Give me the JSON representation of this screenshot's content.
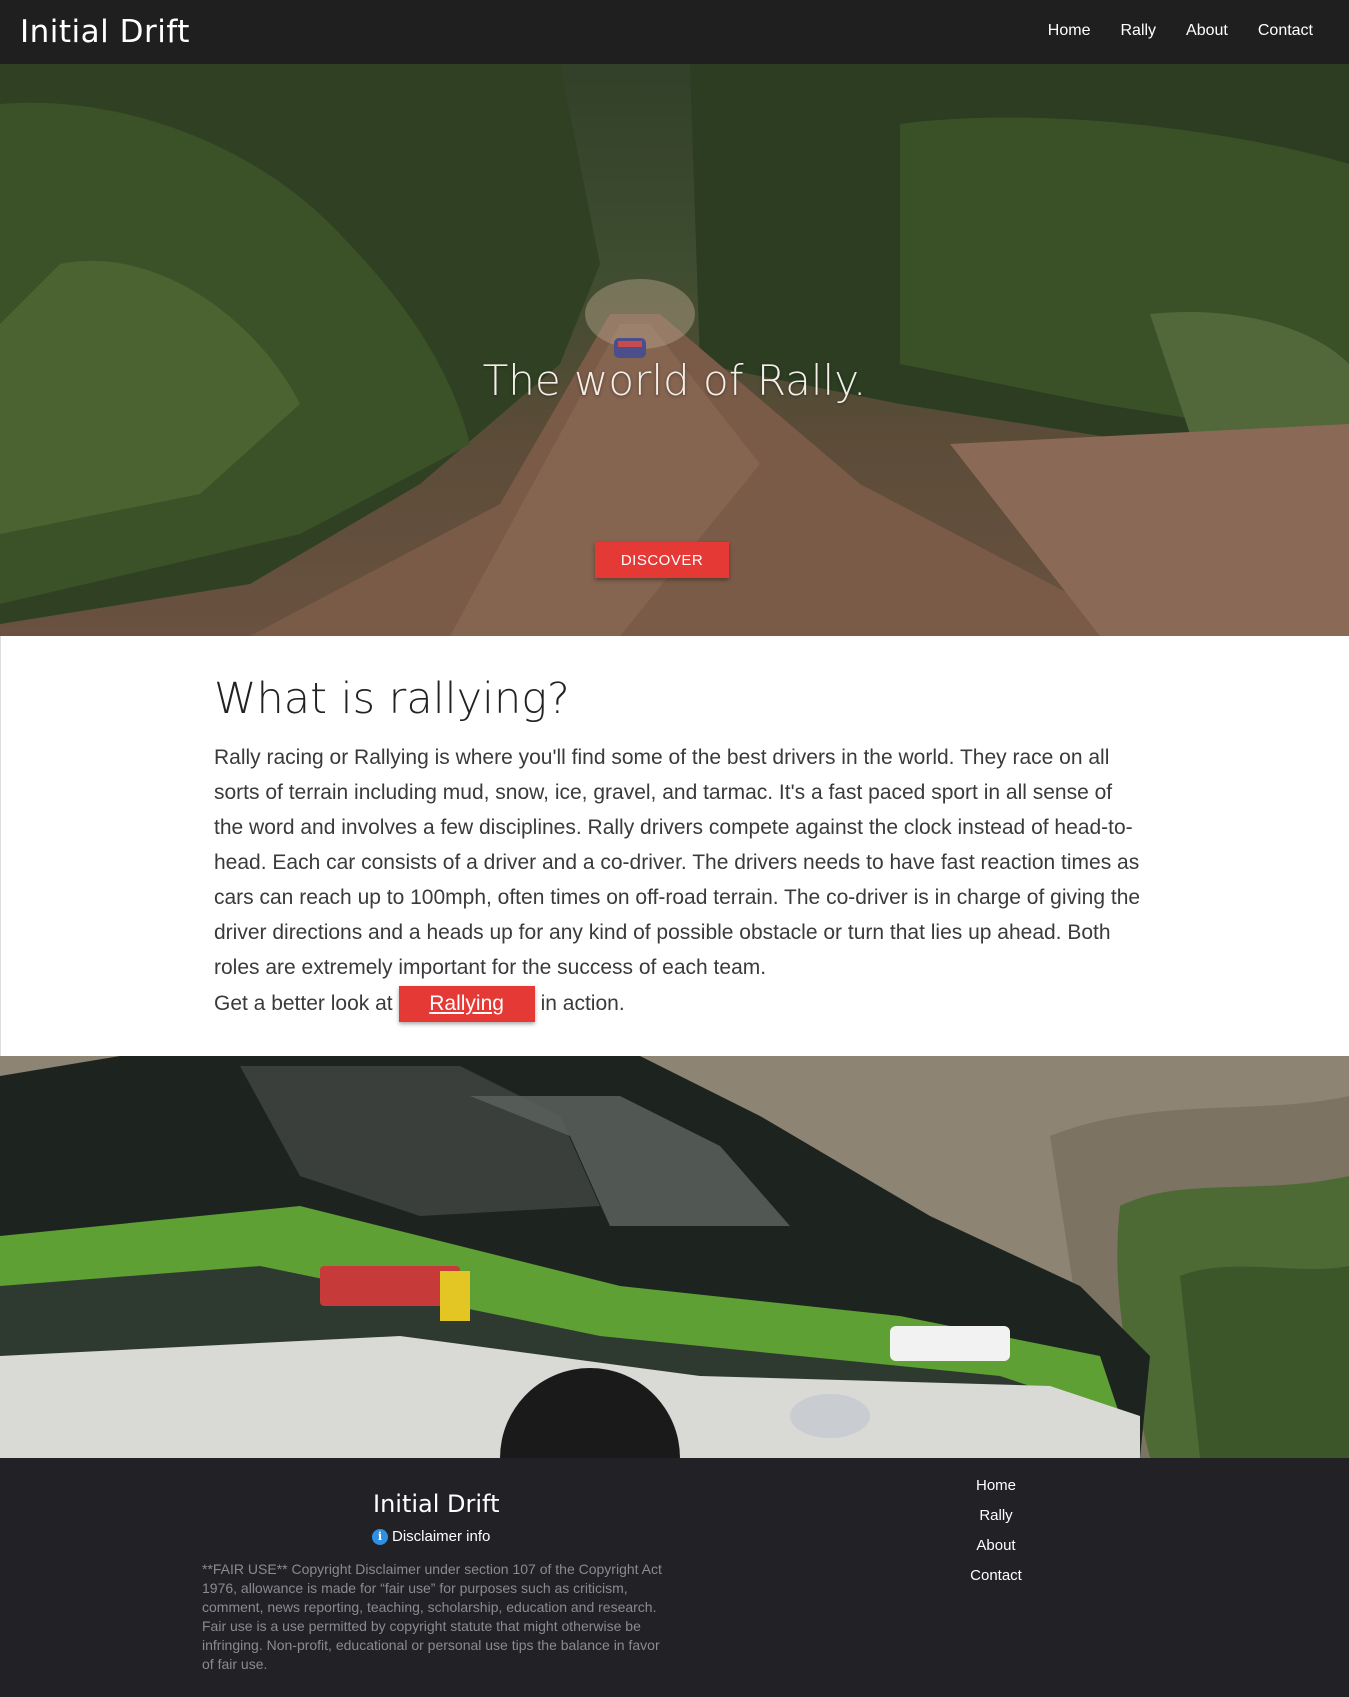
{
  "nav": {
    "brand": "Initial Drift",
    "links": [
      "Home",
      "Rally",
      "About",
      "Contact"
    ]
  },
  "hero": {
    "title": "The world of Rally.",
    "button": "DISCOVER"
  },
  "main": {
    "heading": "What is rallying?",
    "paragraph": "Rally racing or Rallying is where you'll find some of the best drivers in the world. They race on all sorts of terrain including mud, snow, ice, gravel, and tarmac. It's a fast paced sport in all sense of the word and involves a few disciplines. Rally drivers compete against the clock instead of head-to-head. Each car consists of a driver and a co-driver. The drivers needs to have fast reaction times as cars can reach up to 100mph, often times on off-road terrain. The co-driver is in charge of giving the driver directions and a heads up for any kind of possible obstacle or turn that lies up ahead. Both roles are extremely important for the success of each team.",
    "cta_prefix": "Get a better look at",
    "cta_button": "Rallying",
    "cta_suffix": "in action."
  },
  "footer": {
    "brand": "Initial Drift",
    "disclaimer_label": "Disclaimer info",
    "disclaimer_text": "**FAIR USE** Copyright Disclaimer under section 107 of the Copyright Act 1976, allowance is made for “fair use” for purposes such as criticism, comment, news reporting, teaching, scholarship, education and research. Fair use is a use permitted by copyright statute that might otherwise be infringing. Non-profit, educational or personal use tips the balance in favor of fair use.",
    "links": [
      "Home",
      "Rally",
      "About",
      "Contact"
    ]
  },
  "colors": {
    "accent": "#e53935",
    "nav_bg": "#1f1f1f",
    "footer_bg": "#212126",
    "info_icon": "#2f8fe3"
  },
  "icons": {
    "disclaimer": "info-circle-icon"
  }
}
